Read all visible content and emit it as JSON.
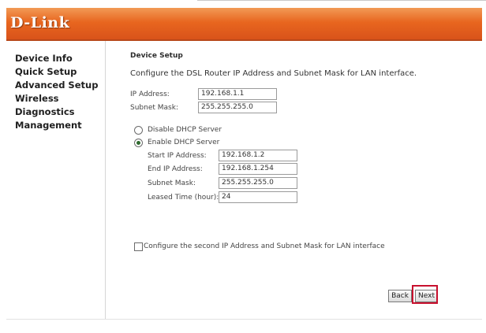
{
  "brand": {
    "logo_text": "D-Link"
  },
  "sidebar": {
    "items": [
      {
        "label": "Device Info"
      },
      {
        "label": "Quick Setup"
      },
      {
        "label": "Advanced Setup"
      },
      {
        "label": "Wireless"
      },
      {
        "label": "Diagnostics"
      },
      {
        "label": "Management"
      }
    ]
  },
  "main": {
    "section_title": "Device Setup",
    "description": "Configure the DSL Router IP Address and Subnet Mask for LAN interface.",
    "ip_address": {
      "label": "IP Address:",
      "value": "192.168.1.1"
    },
    "subnet_mask": {
      "label": "Subnet Mask:",
      "value": "255.255.255.0"
    },
    "dhcp": {
      "disable_label": "Disable DHCP Server",
      "enable_label": "Enable DHCP Server",
      "selected": "enable",
      "start_ip": {
        "label": "Start IP Address:",
        "value": "192.168.1.2"
      },
      "end_ip": {
        "label": "End IP Address:",
        "value": "192.168.1.254"
      },
      "subnet_mask": {
        "label": "Subnet Mask:",
        "value": "255.255.255.0"
      },
      "leased_time": {
        "label": "Leased Time (hour):",
        "value": "24"
      }
    },
    "second_ip_checkbox": {
      "label": "Configure the second IP Address and Subnet Mask for LAN interface",
      "checked": false
    }
  },
  "buttons": {
    "back_label": "Back",
    "next_label": "Next"
  },
  "colors": {
    "banner": "#e8661f",
    "highlight": "#c8102e"
  }
}
